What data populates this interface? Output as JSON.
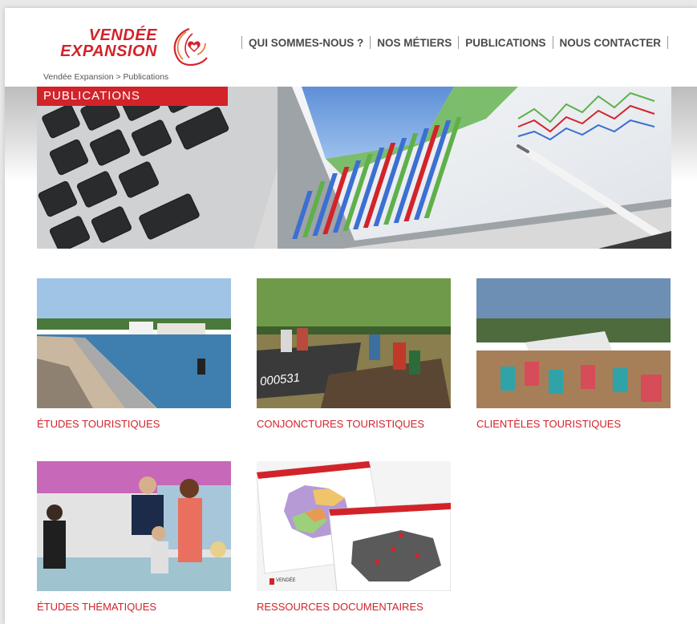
{
  "brand": {
    "line1": "VENDÉE",
    "line2": "EXPANSION",
    "color": "#d2232a"
  },
  "nav": {
    "items": [
      {
        "label": "QUI SOMMES-NOUS ?"
      },
      {
        "label": "NOS MÉTIERS"
      },
      {
        "label": "PUBLICATIONS"
      },
      {
        "label": "NOUS CONTACTER"
      }
    ]
  },
  "breadcrumb": {
    "home": "Vendée Expansion",
    "separator": " > ",
    "current": "Publications"
  },
  "hero": {
    "badge": "PUBLICATIONS"
  },
  "cards": [
    {
      "label": "ÉTUDES TOURISTIQUES"
    },
    {
      "label": "CONJONCTURES TOURISTIQUES"
    },
    {
      "label": "CLIENTÈLES TOURISTIQUES"
    },
    {
      "label": "ÉTUDES THÉMATIQUES"
    },
    {
      "label": "RESSOURCES DOCUMENTAIRES"
    }
  ],
  "boat_number": "000531",
  "map_doc": {
    "logo_text": "VENDÉE"
  }
}
